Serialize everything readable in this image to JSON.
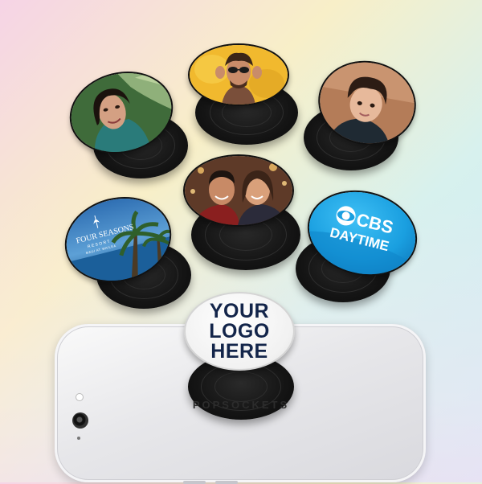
{
  "product": {
    "brand_text": "POPSOCKETS",
    "custom_cap_lines": [
      "YOUR",
      "LOGO",
      "HERE"
    ],
    "sample_logos": {
      "four_seasons_line1": "FOUR SEASONS",
      "four_seasons_line2": "RESORT",
      "four_seasons_line3": "MAUI AT WAILEA",
      "cbs_line1": "CBS",
      "cbs_line2": "DAYTIME"
    }
  },
  "colors": {
    "custom_text": "#13254a",
    "cbs_blue": "#1a9fe0",
    "base_black": "#141414"
  }
}
